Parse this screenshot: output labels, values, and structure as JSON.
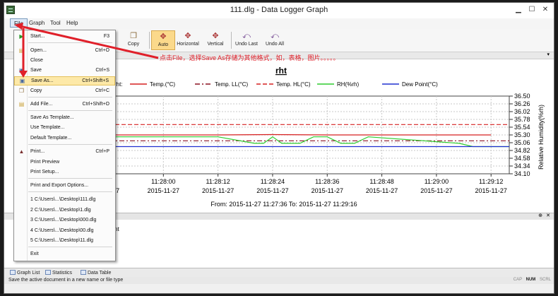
{
  "window": {
    "title": "111.dlg - Data Logger Graph"
  },
  "menubar": {
    "file": "File",
    "graph": "Graph",
    "tool": "Tool",
    "help": "Help"
  },
  "toolbar": {
    "copy": "Copy",
    "auto": "Auto",
    "horizontal": "Horizontal",
    "vertical": "Vertical",
    "undo_last": "Undo Last",
    "undo_all": "Undo All"
  },
  "file_menu": {
    "items": [
      {
        "label": "Start...",
        "shortcut": "F3"
      },
      {
        "label": "Open...",
        "shortcut": "Ctrl+O"
      },
      {
        "label": "Close",
        "shortcut": ""
      },
      {
        "label": "Save",
        "shortcut": "Ctrl+S"
      },
      {
        "label": "Save As...",
        "shortcut": "Ctrl+Shift+S"
      },
      {
        "label": "Copy",
        "shortcut": "Ctrl+C"
      },
      {
        "label": "Add File...",
        "shortcut": "Ctrl+Shift+O"
      },
      {
        "label": "Save As Template...",
        "shortcut": ""
      },
      {
        "label": "Use Template...",
        "shortcut": ""
      },
      {
        "label": "Default Template...",
        "shortcut": ""
      },
      {
        "label": "Print...",
        "shortcut": "Ctrl+P"
      },
      {
        "label": "Print Preview",
        "shortcut": ""
      },
      {
        "label": "Print Setup...",
        "shortcut": ""
      },
      {
        "label": "Print and Export Options...",
        "shortcut": ""
      },
      {
        "label": "1 C:\\Users\\...\\Desktop\\111.dlg",
        "shortcut": ""
      },
      {
        "label": "2 C:\\Users\\...\\Desktop\\1.dlg",
        "shortcut": ""
      },
      {
        "label": "3 C:\\Users\\...\\Desktop\\000.dlg",
        "shortcut": ""
      },
      {
        "label": "4 C:\\Users\\...\\Desktop\\00.dlg",
        "shortcut": ""
      },
      {
        "label": "5 C:\\Users\\...\\Desktop\\11.dlg",
        "shortcut": ""
      },
      {
        "label": "Exit",
        "shortcut": ""
      }
    ]
  },
  "annotation": "点击File，选择Save As存储为其他格式，如，表格，图片。。。。。",
  "chart_data": {
    "type": "line",
    "title": "rht",
    "legend_placement": "top",
    "legend_partial": "rht:",
    "x_ticks": [
      {
        "time": "11:27:48",
        "label": "7:48",
        "date": "2015-11-27",
        "date_label": "5-11-27"
      },
      {
        "time": "11:28:00",
        "label": "11:28:00",
        "date": "2015-11-27",
        "date_label": "2015-11-27"
      },
      {
        "time": "11:28:12",
        "label": "11:28:12",
        "date": "2015-11-27",
        "date_label": "2015-11-27"
      },
      {
        "time": "11:28:24",
        "label": "11:28:24",
        "date": "2015-11-27",
        "date_label": "2015-11-27"
      },
      {
        "time": "11:28:36",
        "label": "11:28:36",
        "date": "2015-11-27",
        "date_label": "2015-11-27"
      },
      {
        "time": "11:28:48",
        "label": "11:28:48",
        "date": "2015-11-27",
        "date_label": "2015-11-27"
      },
      {
        "time": "11:29:00",
        "label": "11:29:00",
        "date": "2015-11-27",
        "date_label": "2015-11-27"
      },
      {
        "time": "11:29:12",
        "label": "11:29:12",
        "date": "2015-11-27",
        "date_label": "2015-11-27"
      }
    ],
    "range_label": "From: 2015-11-27 11:27:36  To: 2015-11-27 11:29:16",
    "x_min": "11:27:48",
    "x_max": "11:29:16",
    "y_right": {
      "label": "Relative Humidity(%rh)",
      "min": 34.1,
      "max": 36.5,
      "ticks": [
        36.5,
        36.26,
        36.02,
        35.78,
        35.54,
        35.3,
        35.06,
        34.82,
        34.58,
        34.34,
        34.1
      ],
      "tick_labels": [
        "36.50",
        "36.26",
        "36.02",
        "35.78",
        "35.54",
        "35.30",
        "35.06",
        "34.82",
        "34.58",
        "34.34",
        "34.10"
      ]
    },
    "grid": true,
    "series": [
      {
        "name": "Temp.(°C)",
        "color": "#d62020",
        "style": "solid",
        "x": [
          "11:27:48",
          "11:28:00",
          "11:28:12",
          "11:28:24",
          "11:28:36",
          "11:28:48",
          "11:29:00",
          "11:29:12"
        ],
        "values": [
          35.3,
          35.3,
          35.3,
          35.31,
          35.3,
          35.3,
          35.3,
          35.3
        ]
      },
      {
        "name": "Temp. LL(°C)",
        "color": "#8b1020",
        "style": "dashdot",
        "x": [
          "11:27:48",
          "11:29:16"
        ],
        "values": [
          35.12,
          35.12
        ]
      },
      {
        "name": "Temp. HL(°C)",
        "color": "#d62020",
        "style": "dashed",
        "x": [
          "11:27:48",
          "11:29:16"
        ],
        "values": [
          35.62,
          35.62
        ]
      },
      {
        "name": "RH(%rh)",
        "color": "#2ecc2e",
        "style": "solid",
        "x": [
          "11:27:48",
          "11:28:12",
          "11:28:20",
          "11:28:22",
          "11:28:24",
          "11:28:26",
          "11:28:30",
          "11:28:33",
          "11:28:36",
          "11:28:39",
          "11:28:42",
          "11:28:45",
          "11:29:05",
          "11:29:08",
          "11:29:16"
        ],
        "values": [
          35.24,
          35.24,
          35.04,
          35.04,
          35.24,
          35.04,
          35.04,
          35.24,
          35.24,
          35.04,
          35.04,
          35.24,
          35.04,
          34.94,
          34.94
        ]
      },
      {
        "name": "Dew Point(°C)",
        "color": "#2030d0",
        "style": "solid",
        "x": [
          "11:27:48",
          "11:29:16"
        ],
        "values": [
          34.94,
          34.94
        ]
      }
    ]
  },
  "panels": {
    "lower_text": "nt"
  },
  "tabs": {
    "graph_list": "Graph List",
    "statistics": "Statistics",
    "data_table": "Data Table"
  },
  "status": {
    "message": "Save the active document in a new name or file type",
    "cap": "CAP",
    "num": "NUM",
    "scrl": "SCRL"
  },
  "colors": {
    "accent": "#fbd98b",
    "highlight": "#fde9a8",
    "annotation": "#e0202a"
  }
}
